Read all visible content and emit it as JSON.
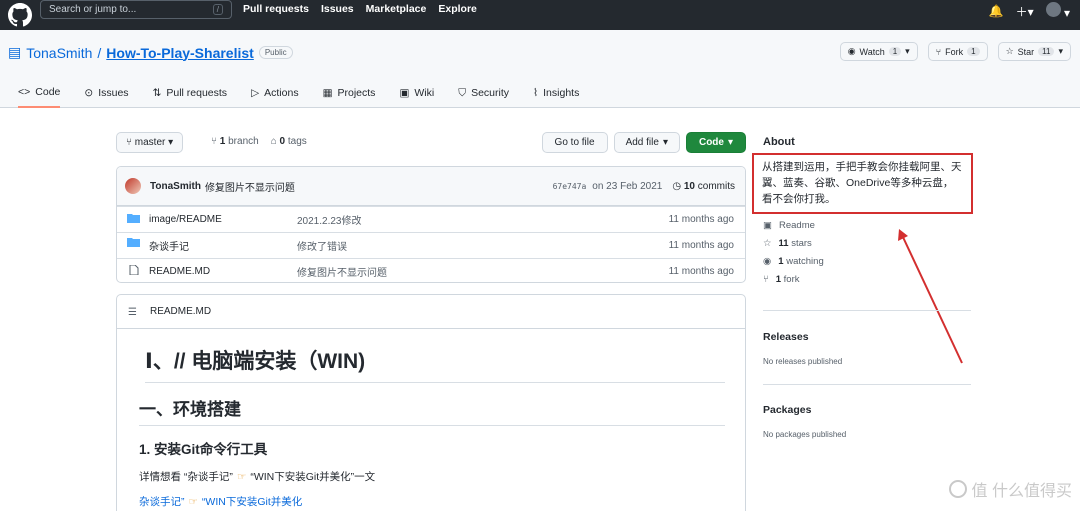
{
  "header": {
    "search_placeholder": "Search or jump to...",
    "slash": "/",
    "nav": [
      "Pull requests",
      "Issues",
      "Marketplace",
      "Explore"
    ]
  },
  "repo": {
    "owner": "TonaSmith",
    "separator": "/",
    "name": "How-To-Play-Sharelist",
    "visibility": "Public",
    "watch_label": "Watch",
    "watch_count": "1",
    "fork_label": "Fork",
    "fork_count": "1",
    "star_label": "Star",
    "star_count": "11"
  },
  "tabs": [
    "Code",
    "Issues",
    "Pull requests",
    "Actions",
    "Projects",
    "Wiki",
    "Security",
    "Insights"
  ],
  "toolbar": {
    "branch": "master",
    "branch_count": "1",
    "branch_label": "branch",
    "tag_count": "0",
    "tag_label": "tags",
    "goto": "Go to file",
    "add_file": "Add file",
    "code": "Code"
  },
  "commit": {
    "author": "TonaSmith",
    "message": "修复图片不显示问题",
    "hash": "67e747a",
    "date": "on 23 Feb 2021",
    "commits_count": "10",
    "commits_label": "commits"
  },
  "files": [
    {
      "name": "image/README",
      "message": "2021.2.23修改",
      "time": "11 months ago",
      "type": "folder"
    },
    {
      "name": "杂谈手记",
      "message": "修改了错误",
      "time": "11 months ago",
      "type": "folder"
    },
    {
      "name": "README.MD",
      "message": "修复图片不显示问题",
      "time": "11 months ago",
      "type": "file"
    }
  ],
  "readme": {
    "filename": "README.MD",
    "h1": "Ⅰ、// 电脑端安装（WIN)",
    "h2": "一、环境搭建",
    "h3": "1. 安装Git命令行工具",
    "p1_a": "详情想看 “杂谈手记”",
    "p1_b": "“WIN下安装Git并美化”一文",
    "p2_a": "杂谈手记”",
    "p2_b": "“WIN下安装Git并美化"
  },
  "about": {
    "title": "About",
    "description": "从搭建到运用，手把手教会你挂载阿里、天翼、蓝奏、谷歌、OneDrive等多种云盘，看不会你打我。",
    "readme": "Readme",
    "stars_count": "11",
    "stars_label": "stars",
    "watching_count": "1",
    "watching_label": "watching",
    "fork_count": "1",
    "fork_label": "fork"
  },
  "releases": {
    "title": "Releases",
    "text": "No releases published"
  },
  "packages": {
    "title": "Packages",
    "text": "No packages published"
  },
  "watermark": "值 什么值得买",
  "colors": {
    "header_bg": "#24292f",
    "highlight": "#d32f2f",
    "green": "#1f883d",
    "link": "#0969da"
  }
}
